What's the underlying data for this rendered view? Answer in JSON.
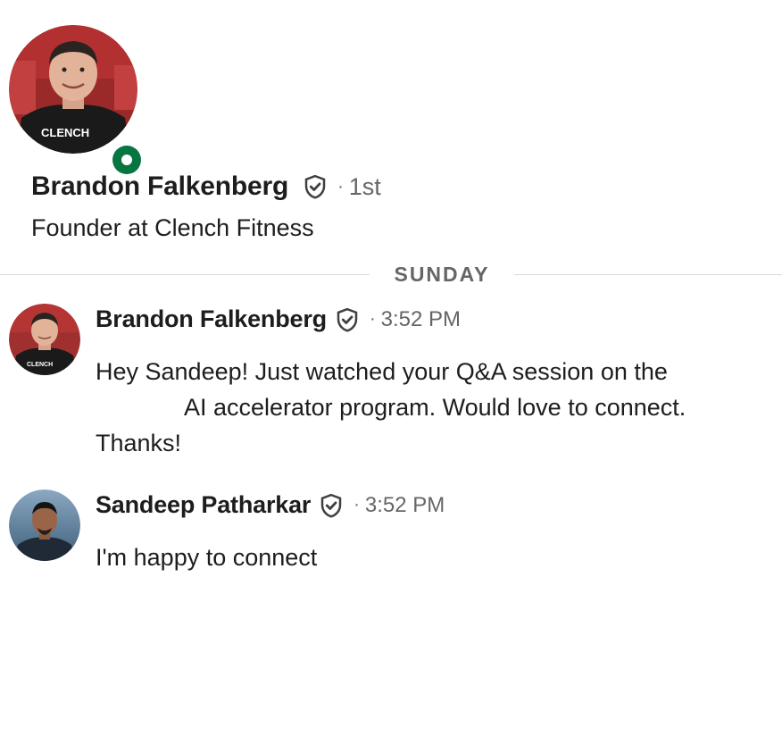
{
  "profile": {
    "name": "Brandon Falkenberg",
    "verified_icon": "verified-shield-icon",
    "separator": "·",
    "degree": "1st",
    "headline": "Founder at Clench Fitness",
    "shirt_text": "CLENCH",
    "online": true,
    "presence_color": "#057642"
  },
  "divider": {
    "label": "SUNDAY"
  },
  "messages": [
    {
      "sender": "Brandon Falkenberg",
      "separator": "·",
      "time": "3:52 PM",
      "avatar_text": "CLENCH",
      "lines": [
        "Hey Sandeep! Just watched your Q&A session on the",
        "AI accelerator program. Would love to connect.",
        "Thanks!"
      ]
    },
    {
      "sender": "Sandeep Patharkar",
      "separator": "·",
      "time": "3:52 PM",
      "lines": [
        "I'm happy to connect"
      ]
    }
  ],
  "colors": {
    "text_primary": "#1d1d1d",
    "text_secondary": "#666666",
    "divider": "#d9d9d9",
    "online_green": "#057642"
  }
}
